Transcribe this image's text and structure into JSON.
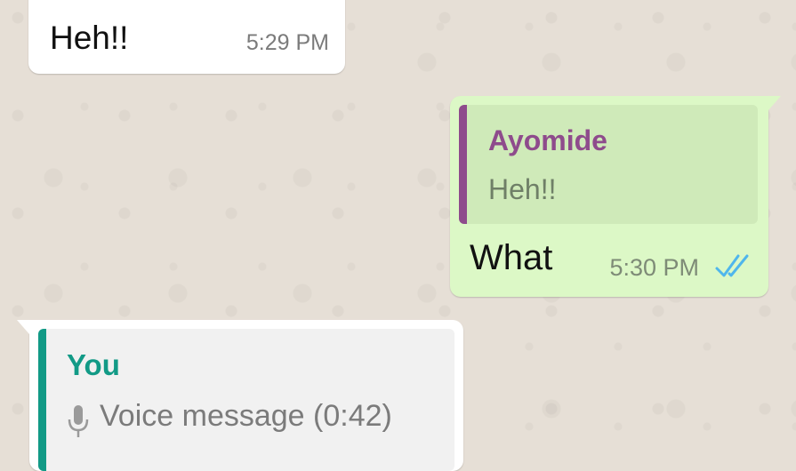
{
  "messages": [
    {
      "direction": "incoming",
      "text": "Heh!!",
      "time": "5:29 PM"
    },
    {
      "direction": "outgoing",
      "quote": {
        "author": "Ayomide",
        "text": "Heh!!"
      },
      "text": "What",
      "time": "5:30 PM",
      "status_icon": "double-check-read-icon"
    },
    {
      "direction": "incoming",
      "quote": {
        "author": "You",
        "icon": "microphone-icon",
        "text": "Voice message (0:42)"
      }
    }
  ],
  "colors": {
    "chat_background": "#e6dfd6",
    "incoming_bubble": "#ffffff",
    "outgoing_bubble": "#dcf8c6",
    "quote_author_outgoing": "#8e4b8c",
    "quote_author_incoming": "#129a86",
    "read_ticks": "#4fb6ec"
  }
}
